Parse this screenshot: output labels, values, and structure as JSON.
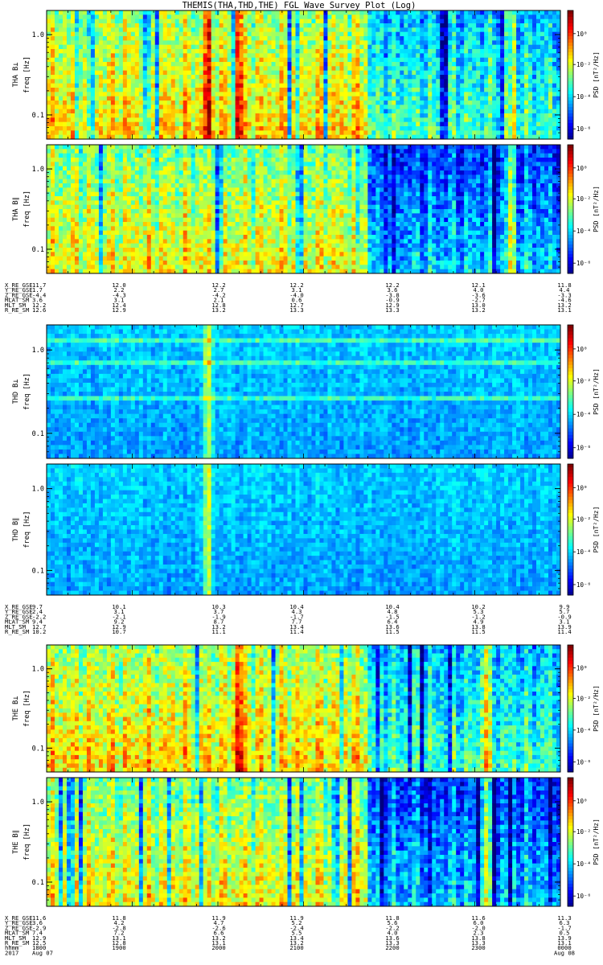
{
  "chart_data": {
    "type": "heatmap",
    "title": "THEMIS(THA,THD,THE) FGL Wave Survey Plot (Log)",
    "colorbar_label": "PSD [nT²/Hz]",
    "colorbar_ticks": [
      "10⁰",
      "10⁻²",
      "10⁻⁴",
      "10⁻⁶"
    ],
    "freq_label": "freq [Hz]",
    "freq_ticks": [
      "1.0",
      "0.1"
    ],
    "freq_range_hz": [
      0.05,
      2.0
    ],
    "time_range_hhmm": [
      "1800",
      "0000"
    ],
    "probes": [
      {
        "panels": [
          {
            "label": "THA B⊥",
            "style": "active",
            "peaks": [
              0.31,
              0.37,
              0.9
            ]
          },
          {
            "label": "THA B∥",
            "style": "active-dark",
            "peaks": [
              0.9
            ]
          }
        ],
        "ephemeris": [
          {
            "name": "X_RE_GSE",
            "values": [
              "11.7",
              "12.0",
              "12.2",
              "12.2",
              "12.2",
              "12.1",
              "11.8"
            ]
          },
          {
            "name": "Y_RE_GSE",
            "values": [
              "1.7",
              "2.2",
              "2.7",
              "3.1",
              "3.6",
              "4.0",
              "4.4"
            ]
          },
          {
            "name": "Z_RE_GSE",
            "values": [
              "-4.4",
              "-4.3",
              "-4.2",
              "-4.0",
              "-3.8",
              "-3.6",
              "-3.3"
            ]
          },
          {
            "name": "MLAT_SM",
            "values": [
              "3.6",
              "3.1",
              "2.1",
              "0.6",
              "-0.9",
              "-2.7",
              "-4.6"
            ]
          },
          {
            "name": "MLT_SM",
            "values": [
              "12.2",
              "12.4",
              "12.8",
              "12.7",
              "12.9",
              "13.0",
              "13.2"
            ]
          },
          {
            "name": "R_RE_SM",
            "values": [
              "12.6",
              "12.9",
              "13.2",
              "13.3",
              "13.3",
              "13.2",
              "13.1"
            ]
          }
        ]
      },
      {
        "panels": [
          {
            "label": "THD B⊥",
            "style": "quiet",
            "peaks": [
              0.31
            ]
          },
          {
            "label": "THD B∥",
            "style": "quiet-dark",
            "peaks": [
              0.31
            ]
          }
        ],
        "ephemeris": [
          {
            "name": "X_RE_GSE",
            "values": [
              "9.7",
              "10.1",
              "10.3",
              "10.4",
              "10.4",
              "10.2",
              "9.9"
            ]
          },
          {
            "name": "Y_RE_GSE",
            "values": [
              "2.4",
              "3.1",
              "3.7",
              "4.3",
              "4.8",
              "5.3",
              "5.7"
            ]
          },
          {
            "name": "Z_RE_GSE",
            "values": [
              "-2.2",
              "-2.1",
              "-1.9",
              "-1.7",
              "-1.5",
              "-1.2",
              "-0.9"
            ]
          },
          {
            "name": "MLAT_SM",
            "values": [
              "9.4",
              "9.2",
              "8.7",
              "7.7",
              "6.4",
              "4.9",
              "3.1"
            ]
          },
          {
            "name": "MLT_SM",
            "values": [
              "12.7",
              "12.9",
              "13.2",
              "13.4",
              "13.6",
              "13.8",
              "13.9"
            ]
          },
          {
            "name": "R_RE_SM",
            "values": [
              "10.2",
              "10.7",
              "11.1",
              "11.4",
              "11.5",
              "11.5",
              "11.4"
            ]
          }
        ]
      },
      {
        "panels": [
          {
            "label": "THE B⊥",
            "style": "active",
            "peaks": [
              0.37,
              0.85
            ]
          },
          {
            "label": "THE B∥",
            "style": "active-dark",
            "peaks": [
              0.85
            ]
          }
        ],
        "ephemeris": [
          {
            "name": "X_RE_GSE",
            "values": [
              "11.6",
              "11.8",
              "11.9",
              "11.9",
              "11.8",
              "11.6",
              "11.3"
            ]
          },
          {
            "name": "Y_RE_GSE",
            "values": [
              "3.6",
              "4.2",
              "4.7",
              "5.2",
              "5.6",
              "6.0",
              "6.3"
            ]
          },
          {
            "name": "Z_RE_GSE",
            "values": [
              "-2.9",
              "-2.8",
              "-2.6",
              "-2.4",
              "-2.2",
              "-2.0",
              "-1.7"
            ]
          },
          {
            "name": "MLAT_SM",
            "values": [
              "7.4",
              "7.2",
              "6.6",
              "5.5",
              "4.0",
              "2.3",
              "0.5"
            ]
          },
          {
            "name": "MLT_SM",
            "values": [
              "12.9",
              "13.1",
              "13.2",
              "13.4",
              "13.6",
              "13.8",
              "13.9"
            ]
          },
          {
            "name": "R_RE_SM",
            "values": [
              "12.5",
              "12.8",
              "13.1",
              "13.2",
              "13.3",
              "13.3",
              "13.1"
            ]
          }
        ],
        "time_axis": {
          "hhmm": [
            "1800",
            "1900",
            "2000",
            "2100",
            "2200",
            "2300",
            "0000"
          ],
          "row_label": "hhmm",
          "date_year": "2017",
          "date_start": "Aug 07",
          "date_end": "Aug 08"
        }
      }
    ]
  }
}
